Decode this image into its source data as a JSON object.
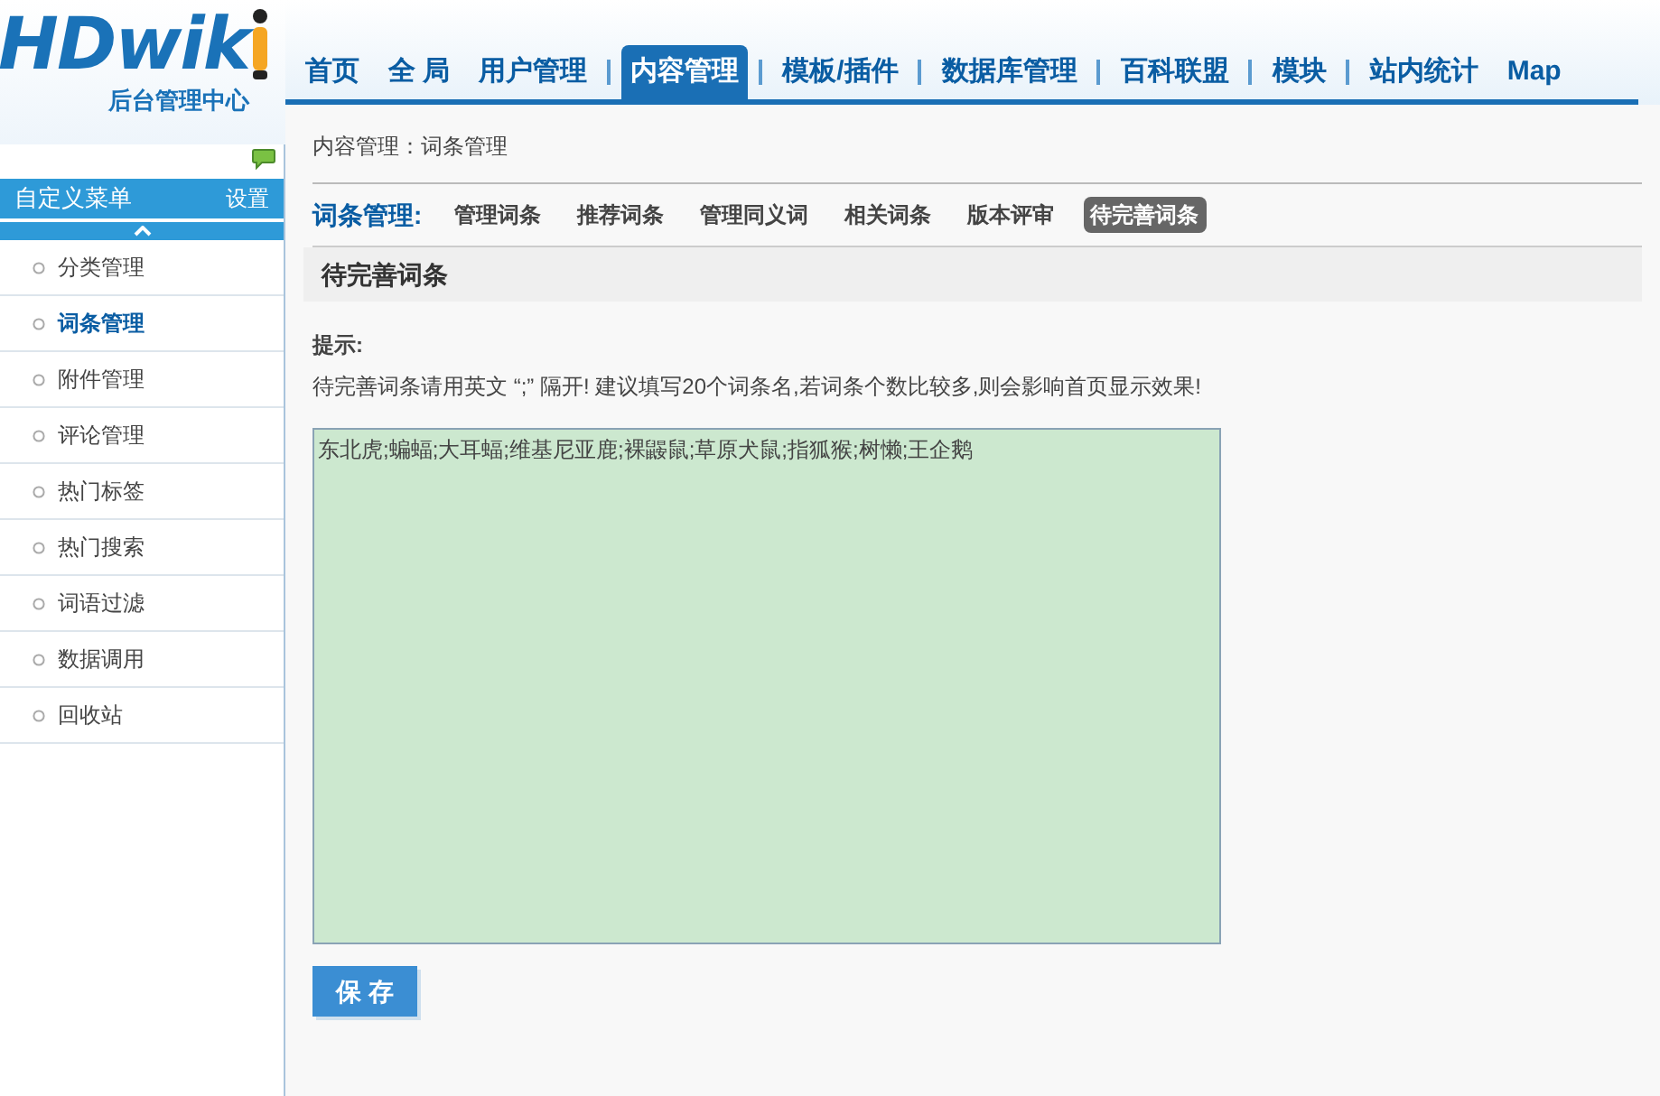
{
  "logo": {
    "wordmark": "HDwik",
    "subtitle": "后台管理中心"
  },
  "top_nav": [
    {
      "label": "首页",
      "selected": false
    },
    {
      "label": "全 局",
      "selected": false
    },
    {
      "label": "用户管理",
      "selected": false
    },
    {
      "label": "内容管理",
      "selected": true
    },
    {
      "label": "模板/插件",
      "selected": false
    },
    {
      "label": "数据库管理",
      "selected": false
    },
    {
      "label": "百科联盟",
      "selected": false
    },
    {
      "label": "模块",
      "selected": false
    },
    {
      "label": "站内统计",
      "selected": false
    },
    {
      "label": "Map",
      "selected": false
    }
  ],
  "sidebar": {
    "title": "自定义菜单",
    "settings": "设置",
    "items": [
      {
        "label": "分类管理",
        "selected": false
      },
      {
        "label": "词条管理",
        "selected": true
      },
      {
        "label": "附件管理",
        "selected": false
      },
      {
        "label": "评论管理",
        "selected": false
      },
      {
        "label": "热门标签",
        "selected": false
      },
      {
        "label": "热门搜索",
        "selected": false
      },
      {
        "label": "词语过滤",
        "selected": false
      },
      {
        "label": "数据调用",
        "selected": false
      },
      {
        "label": "回收站",
        "selected": false
      }
    ]
  },
  "breadcrumb": "内容管理：词条管理",
  "sub_nav": {
    "title": "词条管理:",
    "tabs": [
      {
        "label": "管理词条",
        "selected": false
      },
      {
        "label": "推荐词条",
        "selected": false
      },
      {
        "label": "管理同义词",
        "selected": false
      },
      {
        "label": "相关词条",
        "selected": false
      },
      {
        "label": "版本评审",
        "selected": false
      },
      {
        "label": "待完善词条",
        "selected": true
      }
    ]
  },
  "section_title": "待完善词条",
  "hint": {
    "title": "提示:",
    "text": "待完善词条请用英文 “;” 隔开! 建议填写20个词条名,若词条个数比较多,则会影响首页显示效果!"
  },
  "entries_value": "东北虎;蝙蝠;大耳蝠;维基尼亚鹿;裸鼹鼠;草原犬鼠;指狐猴;树懒;王企鹅",
  "save_button": "保 存"
}
